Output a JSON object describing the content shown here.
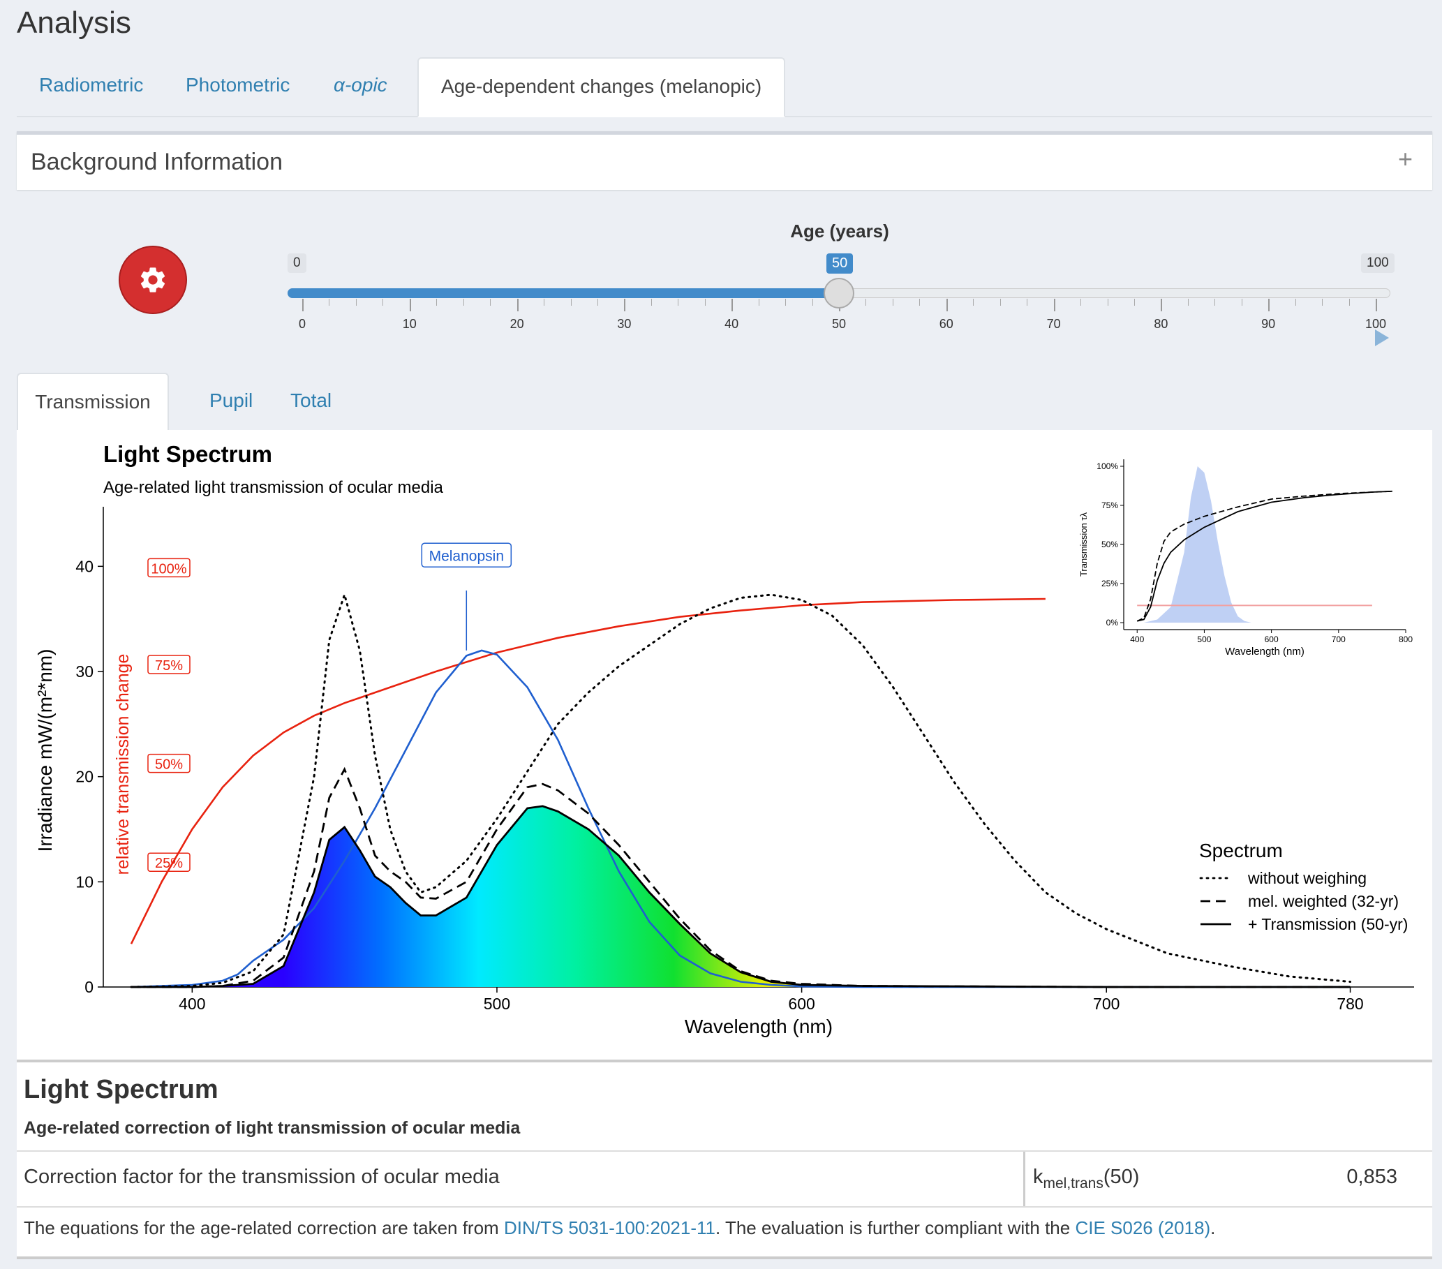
{
  "header": {
    "title": "Analysis"
  },
  "main_tabs": [
    {
      "label": "Radiometric"
    },
    {
      "label": "Photometric"
    },
    {
      "label": "α-opic"
    },
    {
      "label": "Age-dependent changes (melanopic)"
    }
  ],
  "background_panel": {
    "title": "Background Information",
    "toggle": "+"
  },
  "age_slider": {
    "label": "Age (years)",
    "min": "0",
    "max": "100",
    "value": "50",
    "ticks": [
      "0",
      "10",
      "20",
      "30",
      "40",
      "50",
      "60",
      "70",
      "80",
      "90",
      "100"
    ],
    "fraction": 0.5
  },
  "sub_tabs": [
    {
      "label": "Transmission"
    },
    {
      "label": "Pupil"
    },
    {
      "label": "Total"
    }
  ],
  "chart_data": {
    "type": "line",
    "title": "Light Spectrum",
    "subtitle": "Age-related light transmission of ocular media",
    "xlabel": "Wavelength (nm)",
    "ylabel": "Irradiance  mW/(m²*nm)",
    "y2label": "relative transmission change",
    "xlim": [
      380,
      780
    ],
    "ylim": [
      0,
      45
    ],
    "xticks": [
      "400",
      "500",
      "600",
      "700",
      "780"
    ],
    "yticks": [
      "0",
      "10",
      "20",
      "30",
      "40"
    ],
    "pct_labels": [
      "100%",
      "75%",
      "50%",
      "25%"
    ],
    "annotation": "Melanopsin",
    "legend": {
      "title": "Spectrum",
      "items": [
        "without weighing",
        "mel. weighted (32-yr)",
        "+ Transmission (50-yr)"
      ],
      "position": "right"
    },
    "series": [
      {
        "name": "without weighing",
        "x": [
          380,
          400,
          410,
          420,
          430,
          440,
          445,
          450,
          455,
          460,
          465,
          470,
          475,
          480,
          490,
          500,
          510,
          520,
          530,
          540,
          550,
          560,
          570,
          580,
          590,
          600,
          610,
          620,
          630,
          640,
          650,
          660,
          670,
          680,
          690,
          700,
          720,
          740,
          760,
          780
        ],
        "y": [
          0,
          0.1,
          0.4,
          1.5,
          5,
          20,
          33,
          37.3,
          32,
          22,
          15,
          11,
          9,
          9.5,
          12,
          16,
          20.5,
          25,
          28,
          30.5,
          32.5,
          34.5,
          36,
          37,
          37.3,
          36.8,
          35.3,
          32.5,
          28.5,
          24,
          19.5,
          15.5,
          12,
          9,
          7,
          5.5,
          3.2,
          2,
          1,
          0.5
        ]
      },
      {
        "name": "mel. weighted (32-yr)",
        "x": [
          380,
          400,
          410,
          420,
          430,
          440,
          445,
          450,
          455,
          460,
          465,
          470,
          475,
          480,
          490,
          500,
          510,
          515,
          520,
          530,
          540,
          550,
          560,
          570,
          580,
          590,
          600,
          620,
          700,
          780
        ],
        "y": [
          0,
          0,
          0.1,
          0.6,
          2.8,
          11,
          18,
          20.7,
          17,
          12.5,
          11,
          10,
          8.5,
          8.4,
          10,
          15,
          19,
          19.3,
          18.7,
          16.5,
          13.5,
          10,
          6.5,
          3.5,
          1.5,
          0.6,
          0.3,
          0.1,
          0,
          0
        ]
      },
      {
        "name": "+ Transmission (50-yr)",
        "x": [
          380,
          400,
          410,
          420,
          430,
          440,
          445,
          450,
          455,
          460,
          465,
          470,
          475,
          480,
          490,
          500,
          510,
          515,
          520,
          530,
          540,
          550,
          560,
          570,
          580,
          590,
          600,
          620,
          700,
          780
        ],
        "y": [
          0,
          0,
          0.1,
          0.3,
          2,
          9,
          14,
          15.2,
          13,
          10.5,
          9.5,
          8,
          6.8,
          6.8,
          8.5,
          13.5,
          17,
          17.2,
          16.7,
          15,
          12.5,
          9,
          6,
          3.2,
          1.4,
          0.5,
          0.2,
          0.1,
          0,
          0
        ]
      },
      {
        "name": "Melanopsin",
        "x": [
          380,
          400,
          410,
          415,
          420,
          430,
          440,
          450,
          460,
          470,
          480,
          490,
          495,
          500,
          510,
          520,
          530,
          540,
          550,
          560,
          570,
          580,
          590,
          600,
          620,
          700,
          780
        ],
        "y": [
          0,
          0.2,
          0.6,
          1.2,
          2.5,
          4.5,
          7.5,
          12,
          17,
          22.5,
          28,
          31.5,
          32,
          31.6,
          28.5,
          23.5,
          17,
          11,
          6.2,
          3,
          1.3,
          0.5,
          0.2,
          0.05,
          0,
          0,
          0
        ]
      },
      {
        "name": "relative transmission change",
        "x": [
          380,
          390,
          400,
          410,
          420,
          430,
          440,
          450,
          460,
          480,
          500,
          520,
          540,
          560,
          580,
          600,
          620,
          650,
          680
        ],
        "y": [
          4.1,
          10,
          15,
          19,
          22,
          24.2,
          25.8,
          27,
          28,
          30,
          31.8,
          33.2,
          34.3,
          35.2,
          35.8,
          36.3,
          36.6,
          36.8,
          36.9
        ]
      }
    ],
    "inset": {
      "type": "line",
      "xlabel": "Wavelength (nm)",
      "ylabel": "Transmission τλ",
      "xticks": [
        "400",
        "500",
        "600",
        "700",
        "800"
      ],
      "yticks": [
        "0%",
        "25%",
        "50%",
        "75%",
        "100%"
      ],
      "xlim": [
        380,
        800
      ],
      "ylim": [
        0,
        100
      ],
      "series": [
        {
          "name": "melanopic sensitivity",
          "x": [
            410,
            430,
            450,
            470,
            480,
            490,
            500,
            510,
            520,
            530,
            540,
            550,
            560,
            570
          ],
          "y": [
            0,
            2,
            10,
            45,
            80,
            100,
            96,
            78,
            52,
            30,
            13,
            4,
            1,
            0
          ]
        },
        {
          "name": "32-yr",
          "x": [
            400,
            410,
            420,
            430,
            440,
            450,
            470,
            500,
            550,
            600,
            650,
            700,
            750,
            780
          ],
          "y": [
            1,
            3,
            15,
            38,
            52,
            58,
            63,
            68,
            74,
            79,
            81,
            82.5,
            83.5,
            84
          ]
        },
        {
          "name": "50-yr",
          "x": [
            400,
            410,
            420,
            430,
            440,
            450,
            470,
            500,
            550,
            600,
            650,
            700,
            750,
            780
          ],
          "y": [
            1,
            2,
            10,
            27,
            38,
            45,
            53,
            61,
            71,
            77,
            80,
            82,
            83.5,
            84
          ]
        },
        {
          "name": "relative",
          "x": [
            400,
            750
          ],
          "y": [
            11,
            11
          ]
        }
      ]
    }
  },
  "result": {
    "title": "Light Spectrum",
    "subtitle": "Age-related correction of light transmission of ocular media",
    "row_label": "Correction factor for the transmission of ocular media",
    "symbol_base": "k",
    "symbol_sub": "mel,trans",
    "symbol_arg": "(50)",
    "value": "0,853",
    "note_1": "The equations for the age-related correction are taken from ",
    "link_1": "DIN/TS 5031-100:2021-11",
    "note_2": ". The evaluation is further compliant with the ",
    "link_2": "CIE S026 (2018)",
    "note_3": "."
  },
  "colors": {
    "accent": "#428bca",
    "link": "#2f7fb0",
    "danger": "#d42f2f",
    "transmission": "#e8220f",
    "melanopsin": "#1f5fcf"
  }
}
